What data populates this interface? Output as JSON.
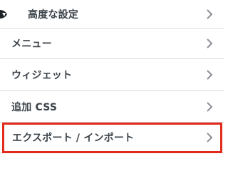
{
  "menu": {
    "items": [
      {
        "label": "高度な設定",
        "icon": "wordpress-partial-icon"
      },
      {
        "label": "メニュー"
      },
      {
        "label": "ウィジェット"
      },
      {
        "label": "追加 CSS"
      },
      {
        "label": "エクスポート / インポート",
        "highlighted": true
      }
    ]
  },
  "colors": {
    "text": "#3c434a",
    "chevron": "#8c8f94",
    "divider": "#dcdcde",
    "highlight_border": "#e22b1c",
    "icon": "#1d2327"
  }
}
